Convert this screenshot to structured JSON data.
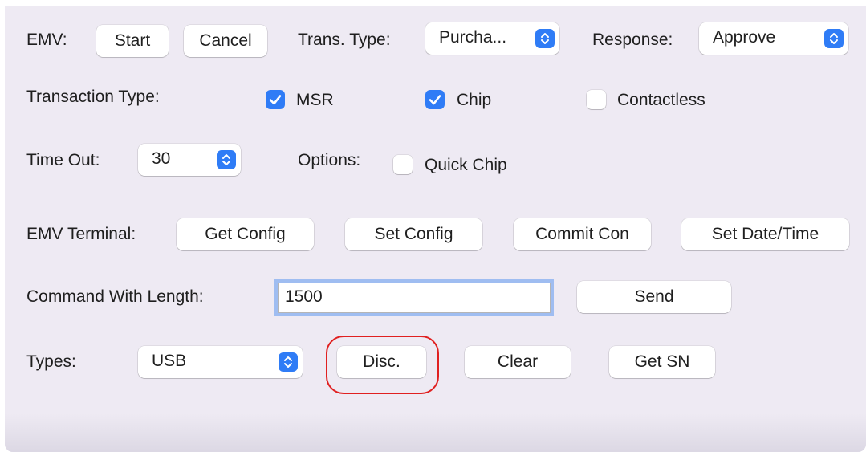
{
  "emv": {
    "label": "EMV:",
    "start_label": "Start",
    "cancel_label": "Cancel",
    "trans_type_label": "Trans. Type:",
    "trans_type_value": "Purcha...",
    "response_label": "Response:",
    "response_value": "Approve"
  },
  "transaction_type": {
    "label": "Transaction Type:",
    "options": [
      {
        "label": "MSR",
        "checked": true
      },
      {
        "label": "Chip",
        "checked": true
      },
      {
        "label": "Contactless",
        "checked": false
      }
    ]
  },
  "timeout": {
    "label": "Time Out:",
    "value": "30",
    "options_label": "Options:",
    "quick_chip_label": "Quick Chip",
    "quick_chip_checked": false
  },
  "terminal": {
    "label": "EMV Terminal:",
    "get_config": "Get Config",
    "set_config": "Set Config",
    "commit_config": "Commit Con",
    "set_datetime": "Set Date/Time"
  },
  "command": {
    "label": "Command With Length:",
    "value": "1500",
    "send_label": "Send"
  },
  "types": {
    "label": "Types:",
    "value": "USB",
    "disconnect_label": "Disc.",
    "clear_label": "Clear",
    "get_sn_label": "Get SN"
  },
  "colors": {
    "accent": "#2f7cf6",
    "background": "#eeeaf3",
    "highlight": "#e02020",
    "focus_ring": "#9fbdf1"
  }
}
